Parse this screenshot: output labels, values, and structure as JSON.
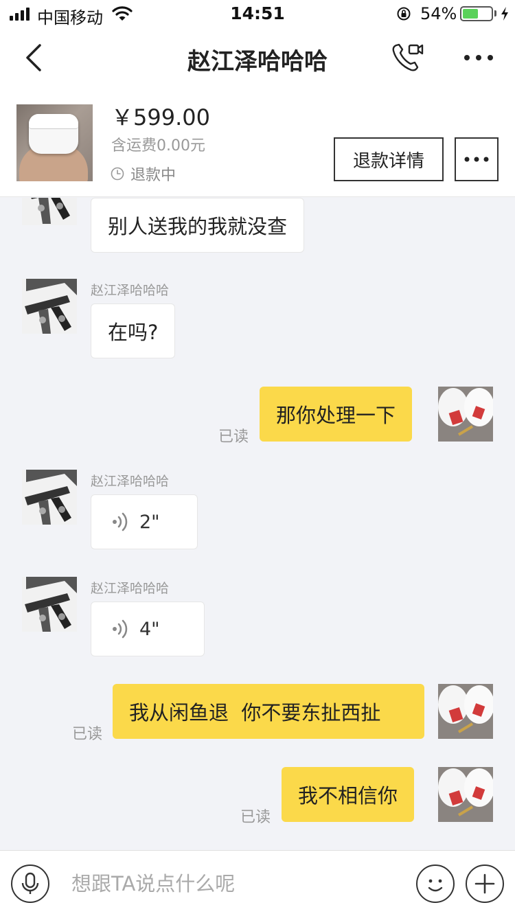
{
  "status_bar": {
    "carrier": "中国移动",
    "time": "14:51",
    "battery_percent": "54%",
    "battery_level": 0.54,
    "battery_color": "#5ad15a"
  },
  "nav": {
    "title": "赵江泽哈哈哈",
    "icons": [
      "back-icon",
      "video-call-icon",
      "more-icon"
    ]
  },
  "order": {
    "price": "￥599.00",
    "shipping": "含运费0.00元",
    "status": "退款中",
    "refund_button": "退款详情",
    "thumbnail": "airpods-case-photo"
  },
  "chat": {
    "messages": [
      {
        "from": "them",
        "type": "text",
        "text": "别人送我的我就没查"
      },
      {
        "from": "them",
        "type": "text",
        "sender": "赵江泽哈哈哈",
        "text": "在吗?"
      },
      {
        "from": "me",
        "type": "text",
        "text": "那你处理一下",
        "read": "已读"
      },
      {
        "from": "them",
        "type": "voice",
        "sender": "赵江泽哈哈哈",
        "duration": "2\""
      },
      {
        "from": "them",
        "type": "voice",
        "sender": "赵江泽哈哈哈",
        "duration": "4\""
      },
      {
        "from": "me",
        "type": "text",
        "text": "我从闲鱼退  你不要东扯西扯",
        "read": "已读"
      },
      {
        "from": "me",
        "type": "text",
        "text": "我不相信你",
        "read": "已读"
      }
    ],
    "bubble_color_me": "#fbd94a",
    "bubble_color_them": "#ffffff"
  },
  "input": {
    "placeholder": "想跟TA说点什么呢",
    "icons": [
      "microphone-icon",
      "emoji-icon",
      "plus-icon"
    ]
  }
}
